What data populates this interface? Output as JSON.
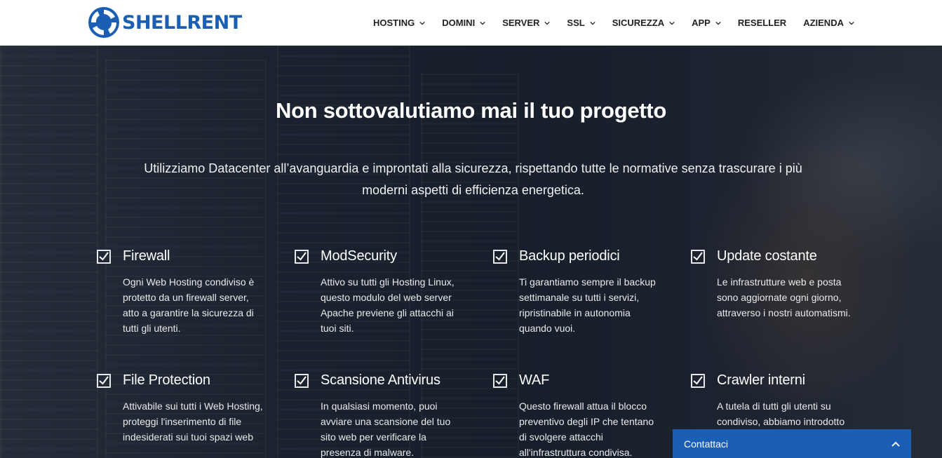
{
  "brand": {
    "name": "SHELLRENT",
    "color": "#1a5fb4"
  },
  "nav": [
    {
      "label": "HOSTING",
      "dropdown": true
    },
    {
      "label": "DOMINI",
      "dropdown": true
    },
    {
      "label": "SERVER",
      "dropdown": true
    },
    {
      "label": "SSL",
      "dropdown": true
    },
    {
      "label": "SICUREZZA",
      "dropdown": true
    },
    {
      "label": "APP",
      "dropdown": true
    },
    {
      "label": "RESELLER",
      "dropdown": false
    },
    {
      "label": "AZIENDA",
      "dropdown": true
    }
  ],
  "hero": {
    "title": "Non sottovalutiamo mai il tuo progetto",
    "subtitle": "Utilizziamo Datacenter all’avanguardia e improntati alla sicurezza, rispettando tutte le normative senza trascurare i più moderni aspetti di efficienza energetica."
  },
  "features": [
    {
      "title": "Firewall",
      "text": "Ogni Web Hosting condiviso è protetto da un firewall server, atto a garantire la sicurezza di tutti gli utenti."
    },
    {
      "title": "ModSecurity",
      "text": "Attivo su tutti gli Hosting Linux, questo modulo del web server Apache previene gli attacchi ai tuoi siti."
    },
    {
      "title": "Backup periodici",
      "text": "Ti garantiamo sempre il backup settimanale su tutti i servizi, ripristinabile in autonomia quando vuoi."
    },
    {
      "title": "Update costante",
      "text": "Le infrastrutture web e posta sono aggiornate ogni giorno, attraverso i nostri automatismi."
    },
    {
      "title": "File Protection",
      "text": "Attivabile sui tutti i Web Hosting, proteggi l'inserimento di file indesiderati sui tuoi spazi web"
    },
    {
      "title": "Scansione Antivirus",
      "text": "In qualsiasi momento, puoi avviare una scansione del tuo sito web per verificare la presenza di malware."
    },
    {
      "title": "WAF",
      "text": "Questo firewall attua il blocco preventivo degli IP che tentano di svolgere attacchi all'infrastruttura condivisa."
    },
    {
      "title": "Crawler interni",
      "text": "A tutela di tutti gli utenti su condiviso, abbiamo introdotto"
    }
  ],
  "contact": {
    "label": "Contattaci"
  },
  "icons": {
    "check": "checkbox-check-icon",
    "chevron": "chevron-down-icon",
    "chevron_up": "chevron-up-icon"
  }
}
